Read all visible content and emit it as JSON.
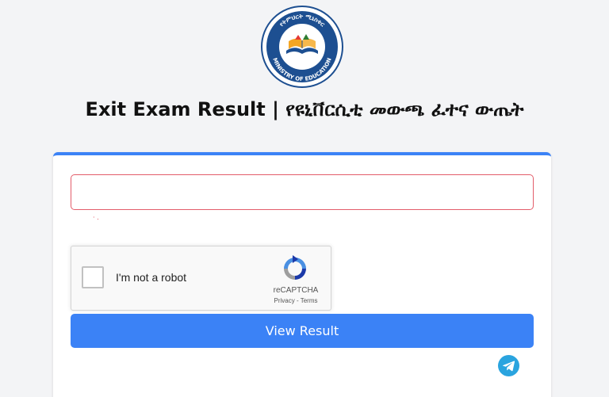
{
  "logo": {
    "arc_text_top": "የትምህርት ሚኒስቴር",
    "arc_text_bottom": "MINISTRY OF EDUCATION",
    "colors": {
      "ring": "#1d4f91",
      "book": "#f5a623",
      "accent": "#e53935"
    }
  },
  "header": {
    "title": "Exit Exam Result | የዩኒቨርሲቲ መውጫ ፈተና ውጤት"
  },
  "form": {
    "id_input": {
      "value": "",
      "placeholder": ""
    },
    "error_text": "· ."
  },
  "recaptcha": {
    "checkbox_label": "I'm not a robot",
    "brand": "reCAPTCHA",
    "privacy_link": "Privacy",
    "separator": " - ",
    "terms_link": "Terms"
  },
  "submit": {
    "label": "View Result"
  },
  "social": {
    "icon": "telegram-icon"
  },
  "colors": {
    "accent": "#3b82f6",
    "error": "#dc3545",
    "background": "#f3f4f6",
    "telegram": "#2aa4df"
  }
}
